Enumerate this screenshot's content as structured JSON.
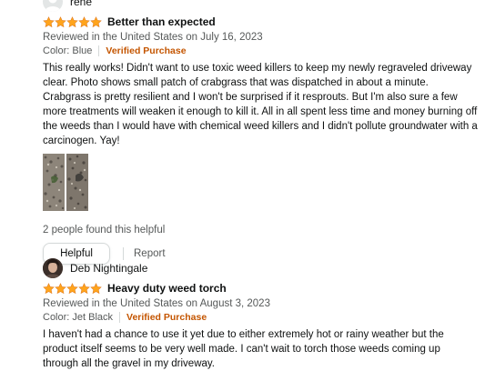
{
  "reviews": [
    {
      "reviewer": "rene",
      "rating": 5,
      "title": "Better than expected",
      "date_line": "Reviewed in the United States on July 16, 2023",
      "color": "Color: Blue",
      "verified": "Verified Purchase",
      "body": "This really works! Didn't want to use toxic weed killers to keep my newly regraveled driveway clear. Photo shows small patch of crabgrass that was dispatched in about a minute. Crabgrass is pretty resilient and I won't be surprised if it resprouts. But I'm also sure a few more treatments will weaken it enough to kill it. All in all spent less time and money burning off the weeds than I would have with chemical weed killers and I didn't pollute groundwater with a carcinogen. Yay!",
      "helpful_count": "2 people found this helpful",
      "helpful_label": "Helpful",
      "report_label": "Report"
    },
    {
      "reviewer": "Deb Nightingale",
      "rating": 5,
      "title": "Heavy duty weed torch",
      "date_line": "Reviewed in the United States on August 3, 2023",
      "color": "Color: Jet Black",
      "verified": "Verified Purchase",
      "body": "I haven't had a chance to use it yet due to either extremely hot or rainy weather but the product itself seems to be very well made. I can't wait to torch those weeds coming up through all the gravel in my driveway."
    }
  ],
  "colors": {
    "star": "#ffa41c",
    "verified": "#c45500",
    "meta_text": "#565959",
    "divider": "#d5d9d9"
  },
  "icons": {
    "generic_avatar": "person-silhouette-icon",
    "star": "star-icon"
  }
}
